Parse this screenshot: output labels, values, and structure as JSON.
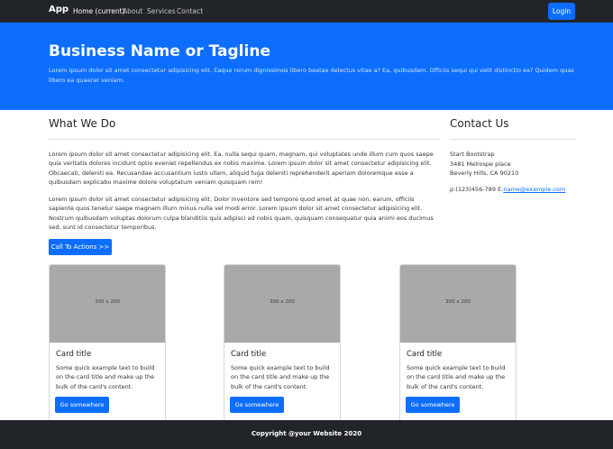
{
  "navbar": {
    "brand": "App",
    "links": [
      "Home (current)",
      "About",
      "Services",
      "Contact"
    ],
    "login_label": "Login"
  },
  "hero": {
    "title": "Business Name or Tagline",
    "text": "Lorem ipsum dolor sit amet consectetur adipisicing elit. Eaque rerum dignissimos libero beatae delectus vitae a? Ea, quibusdam. Officiis sequi qui velit distinctio ea? Quidem quas libero ea quaerat veniam."
  },
  "main": {
    "title": "What We Do",
    "paragraph1": "Lorem ipsum dolor sit amet consectetur adipisicing elit. Ea, nulla sequi quam, magnam, qui voluptates unde illum cum quos saepe quia veritatis dolores incidunt optio eveniet repellendus ex nobis maxime. Lorem ipsum dolor sit amet consectetur adipisicing elit. Obcaecati, deleniti ea. Recusandae accusantium iusto ullam, aliquid fuga deleniti reprehenderit aperiam doloremque esse a quibusdam explicabo maxime dolore voluptatum veniam quisquam rem!",
    "paragraph2": "Lorem ipsum dolor sit amet consectetur adipisicing elit. Dolor inventore sed tempore quod amet at quae non, earum, officiis sapiente quos tenetur saepe magnam illum minus nulla vel modi error. Lorem ipsum dolor sit amet consectetur adipisicing elit. Nostrum quibusdam voluptas dolorum culpa blanditiis quis adipisci ad nobis quam, quisquam consequatur quia animi eos ducimus sed, sunt id consectetur temporibus.",
    "cta_label": "Call To Actions >>"
  },
  "contact": {
    "title": "Contact Us",
    "line1": "Start Bootstrap",
    "line2": "3481 Melrospe place",
    "line3": "Beverly Hills, CA 90210",
    "phone": "p:(123)456-789 E:",
    "email": "name@example.com"
  },
  "cards": [
    {
      "image_label": "300 x 200",
      "title": "Card title",
      "text": "Some quick example text to build on the card title and make up the bulk of the card's content.",
      "button": "Go somewhere"
    },
    {
      "image_label": "300 x 200",
      "title": "Card title",
      "text": "Some quick example text to build on the card title and make up the bulk of the card's content.",
      "button": "Go somewhere"
    },
    {
      "image_label": "300 x 200",
      "title": "Card title",
      "text": "Some quick example text to build on the card title and make up the bulk of the card's content.",
      "button": "Go somewhere"
    }
  ],
  "footer": {
    "text": "Copyright @your Website 2020"
  }
}
